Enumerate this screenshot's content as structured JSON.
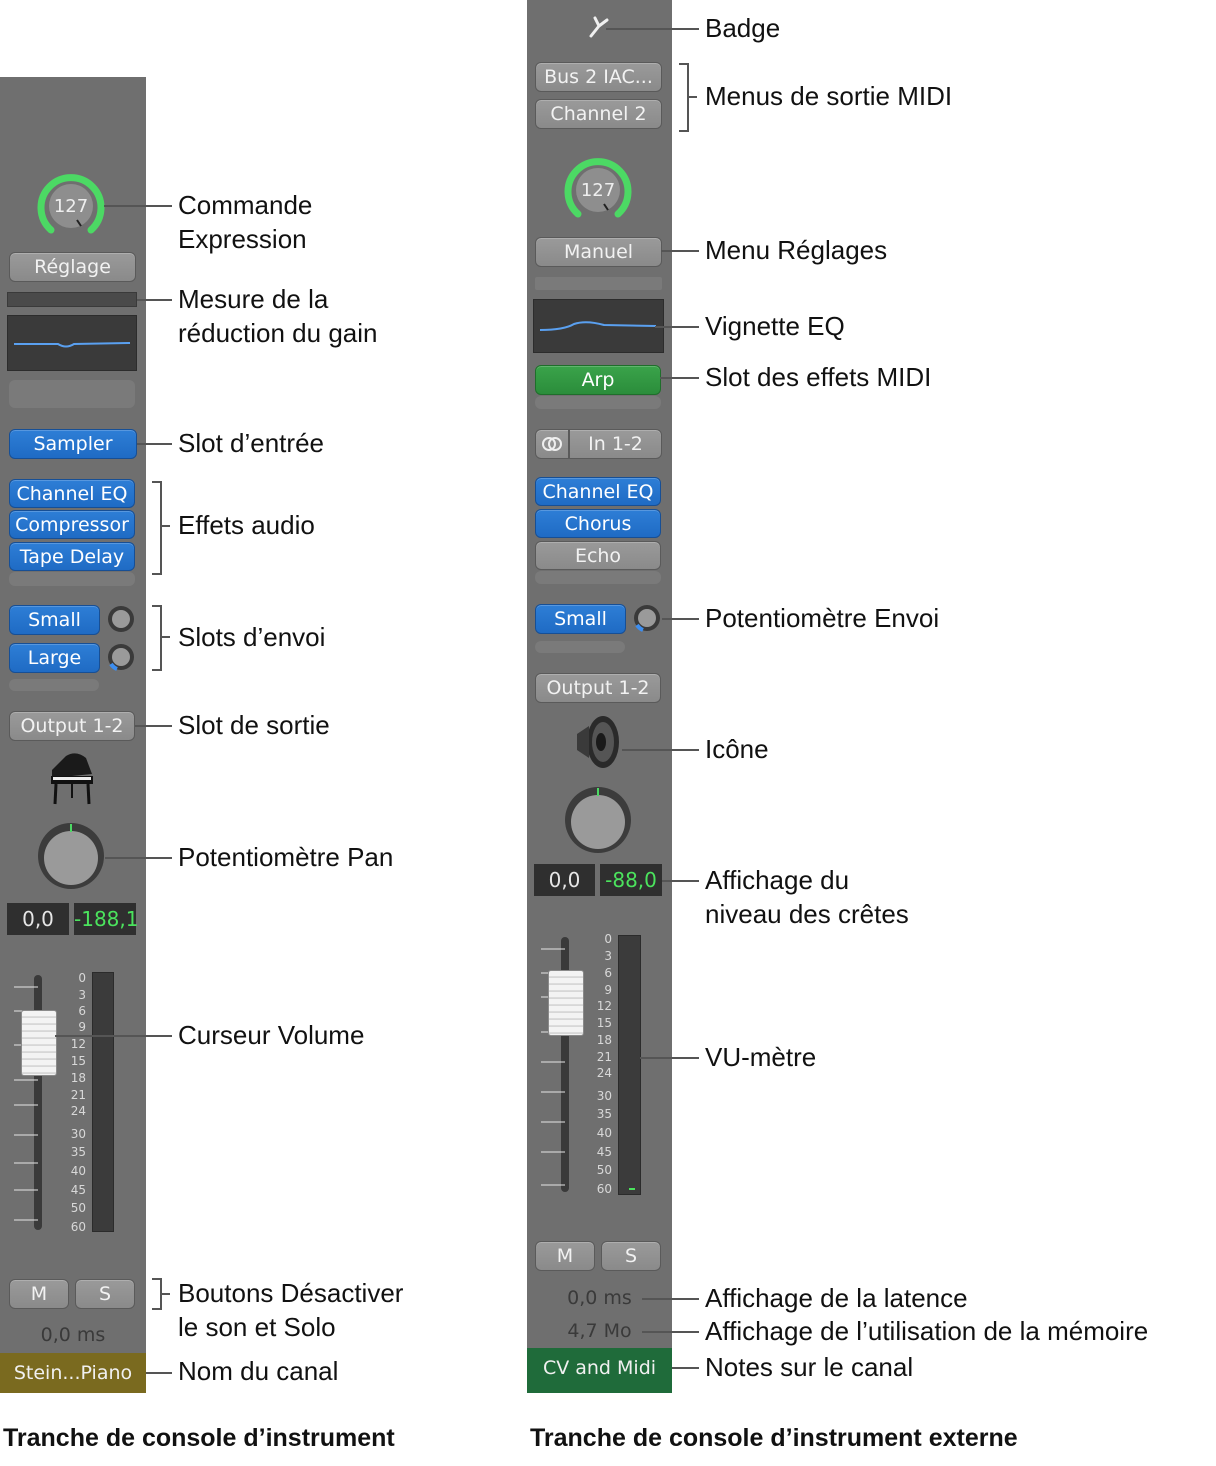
{
  "strip_instrument": {
    "expression_value": "127",
    "setting_label": "Réglage",
    "input_slot": "Sampler",
    "audio_effects": [
      "Channel EQ",
      "Compressor",
      "Tape Delay"
    ],
    "sends": [
      "Small",
      "Large"
    ],
    "output_slot": "Output 1-2",
    "icon": "grand-piano-icon",
    "volume_value": "0,0",
    "peak_value": "-188,1",
    "scale": [
      "0",
      "3",
      "6",
      "9",
      "12",
      "15",
      "18",
      "21",
      "24",
      "30",
      "35",
      "40",
      "45",
      "50",
      "60"
    ],
    "mute_label": "M",
    "solo_label": "S",
    "latency": "0,0 ms",
    "channel_name": "Stein...Piano",
    "caption": "Tranche de console d’instrument"
  },
  "strip_external": {
    "badge_icon": "tuning-fork-icon",
    "midi_output_port": "Bus 2 IAC...",
    "midi_output_channel": "Channel 2",
    "expression_value": "127",
    "setting_label": "Manuel",
    "midi_effect": "Arp",
    "input_slot": "In 1-2",
    "audio_effects": [
      "Channel EQ",
      "Chorus",
      "Echo"
    ],
    "send": "Small",
    "output_slot": "Output 1-2",
    "icon": "speaker-icon",
    "volume_value": "0,0",
    "peak_value": "-88,0",
    "scale": [
      "0",
      "3",
      "6",
      "9",
      "12",
      "15",
      "18",
      "21",
      "24",
      "30",
      "35",
      "40",
      "45",
      "50",
      "60"
    ],
    "mute_label": "M",
    "solo_label": "S",
    "latency": "0,0 ms",
    "memory": "4,7 Mo",
    "channel_notes": "CV and Midi",
    "caption": "Tranche de console d’instrument externe"
  },
  "callouts_left": {
    "expression_line1": "Commande",
    "expression_line2": "Expression",
    "gain_line1": "Mesure de la",
    "gain_line2": "réduction du gain",
    "input_slot": "Slot d’entrée",
    "audio_effects": "Effets audio",
    "send_slots": "Slots d’envoi",
    "output_slot": "Slot de sortie",
    "pan": "Potentiomètre Pan",
    "volume": "Curseur Volume",
    "mute_solo_line1": "Boutons Désactiver",
    "mute_solo_line2": "le son et Solo",
    "channel_name": "Nom du canal"
  },
  "callouts_right": {
    "badge": "Badge",
    "midi_out_menus": "Menus de sortie MIDI",
    "settings_menu": "Menu Réglages",
    "eq_thumbnail": "Vignette EQ",
    "midi_fx_slot": "Slot des effets MIDI",
    "send_knob": "Potentiomètre Envoi",
    "icon": "Icône",
    "peak_line1": "Affichage du",
    "peak_line2": "niveau des crêtes",
    "vu_meter": "VU-mètre",
    "latency": "Affichage de la latence",
    "memory": "Affichage de l’utilisation de la mémoire",
    "notes": "Notes sur le canal"
  },
  "colors": {
    "strip_bg": "#6f6f6f",
    "blue_slot": "#1f6bc4",
    "green_slot": "#2b8d3b",
    "knob_ring": "#4cd964",
    "name_bar_instrument": "#7a6a1f",
    "name_bar_external": "#1f6b3a"
  }
}
